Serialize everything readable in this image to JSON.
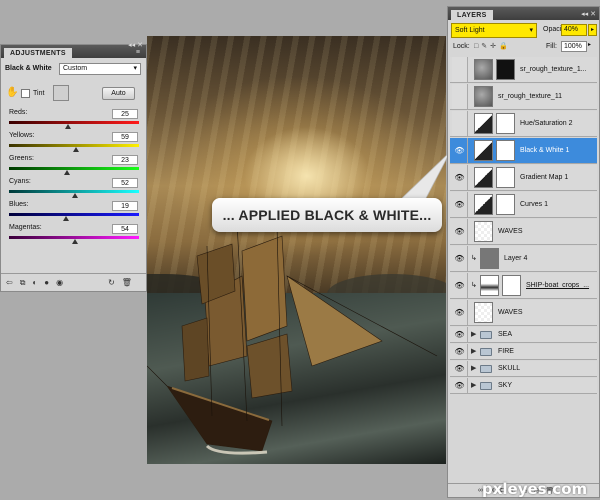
{
  "adjustments": {
    "tab": "ADJUSTMENTS",
    "title": "Black & White",
    "preset": "Custom",
    "tint_label": "Tint",
    "auto_label": "Auto",
    "sliders": [
      {
        "label": "Reds:",
        "value": "25",
        "colors": [
          "#3a0000",
          "#ff1a1a"
        ]
      },
      {
        "label": "Yellows:",
        "value": "59",
        "colors": [
          "#3a3200",
          "#fff000"
        ]
      },
      {
        "label": "Greens:",
        "value": "23",
        "colors": [
          "#003a00",
          "#1aff1a"
        ]
      },
      {
        "label": "Cyans:",
        "value": "52",
        "colors": [
          "#003a3a",
          "#1affff"
        ]
      },
      {
        "label": "Blues:",
        "value": "19",
        "colors": [
          "#00003a",
          "#1a1aff"
        ]
      },
      {
        "label": "Magentas:",
        "value": "54",
        "colors": [
          "#3a003a",
          "#ff1aff"
        ]
      }
    ]
  },
  "layers_panel": {
    "tab": "LAYERS",
    "blend_mode": "Soft Light",
    "opacity_label": "Opacity:",
    "opacity": "40%",
    "lock_label": "Lock:",
    "fill_label": "Fill:",
    "fill": "100%",
    "layers": [
      {
        "name": "sr_rough_texture_1...",
        "visible": false,
        "kind": "masked-texture"
      },
      {
        "name": "sr_rough_texture_11",
        "visible": false,
        "kind": "texture"
      },
      {
        "name": "Hue/Saturation 2",
        "visible": false,
        "kind": "adjustment"
      },
      {
        "name": "Black & White 1",
        "visible": true,
        "kind": "adjustment",
        "selected": true
      },
      {
        "name": "Gradient Map 1",
        "visible": true,
        "kind": "adjustment"
      },
      {
        "name": "Curves 1",
        "visible": true,
        "kind": "adjustment"
      },
      {
        "name": "WAVES",
        "visible": true,
        "kind": "transparent"
      },
      {
        "name": "Layer 4",
        "visible": true,
        "kind": "gray"
      },
      {
        "name": "SHIP-boat_crops_...",
        "visible": true,
        "kind": "ship"
      },
      {
        "name": "WAVES",
        "visible": true,
        "kind": "transparent"
      }
    ],
    "groups": [
      "SEA",
      "FIRE",
      "SKULL",
      "SKY"
    ]
  },
  "callout": "... APPLIED BLACK & WHITE...",
  "watermark": "pxleyes.com"
}
